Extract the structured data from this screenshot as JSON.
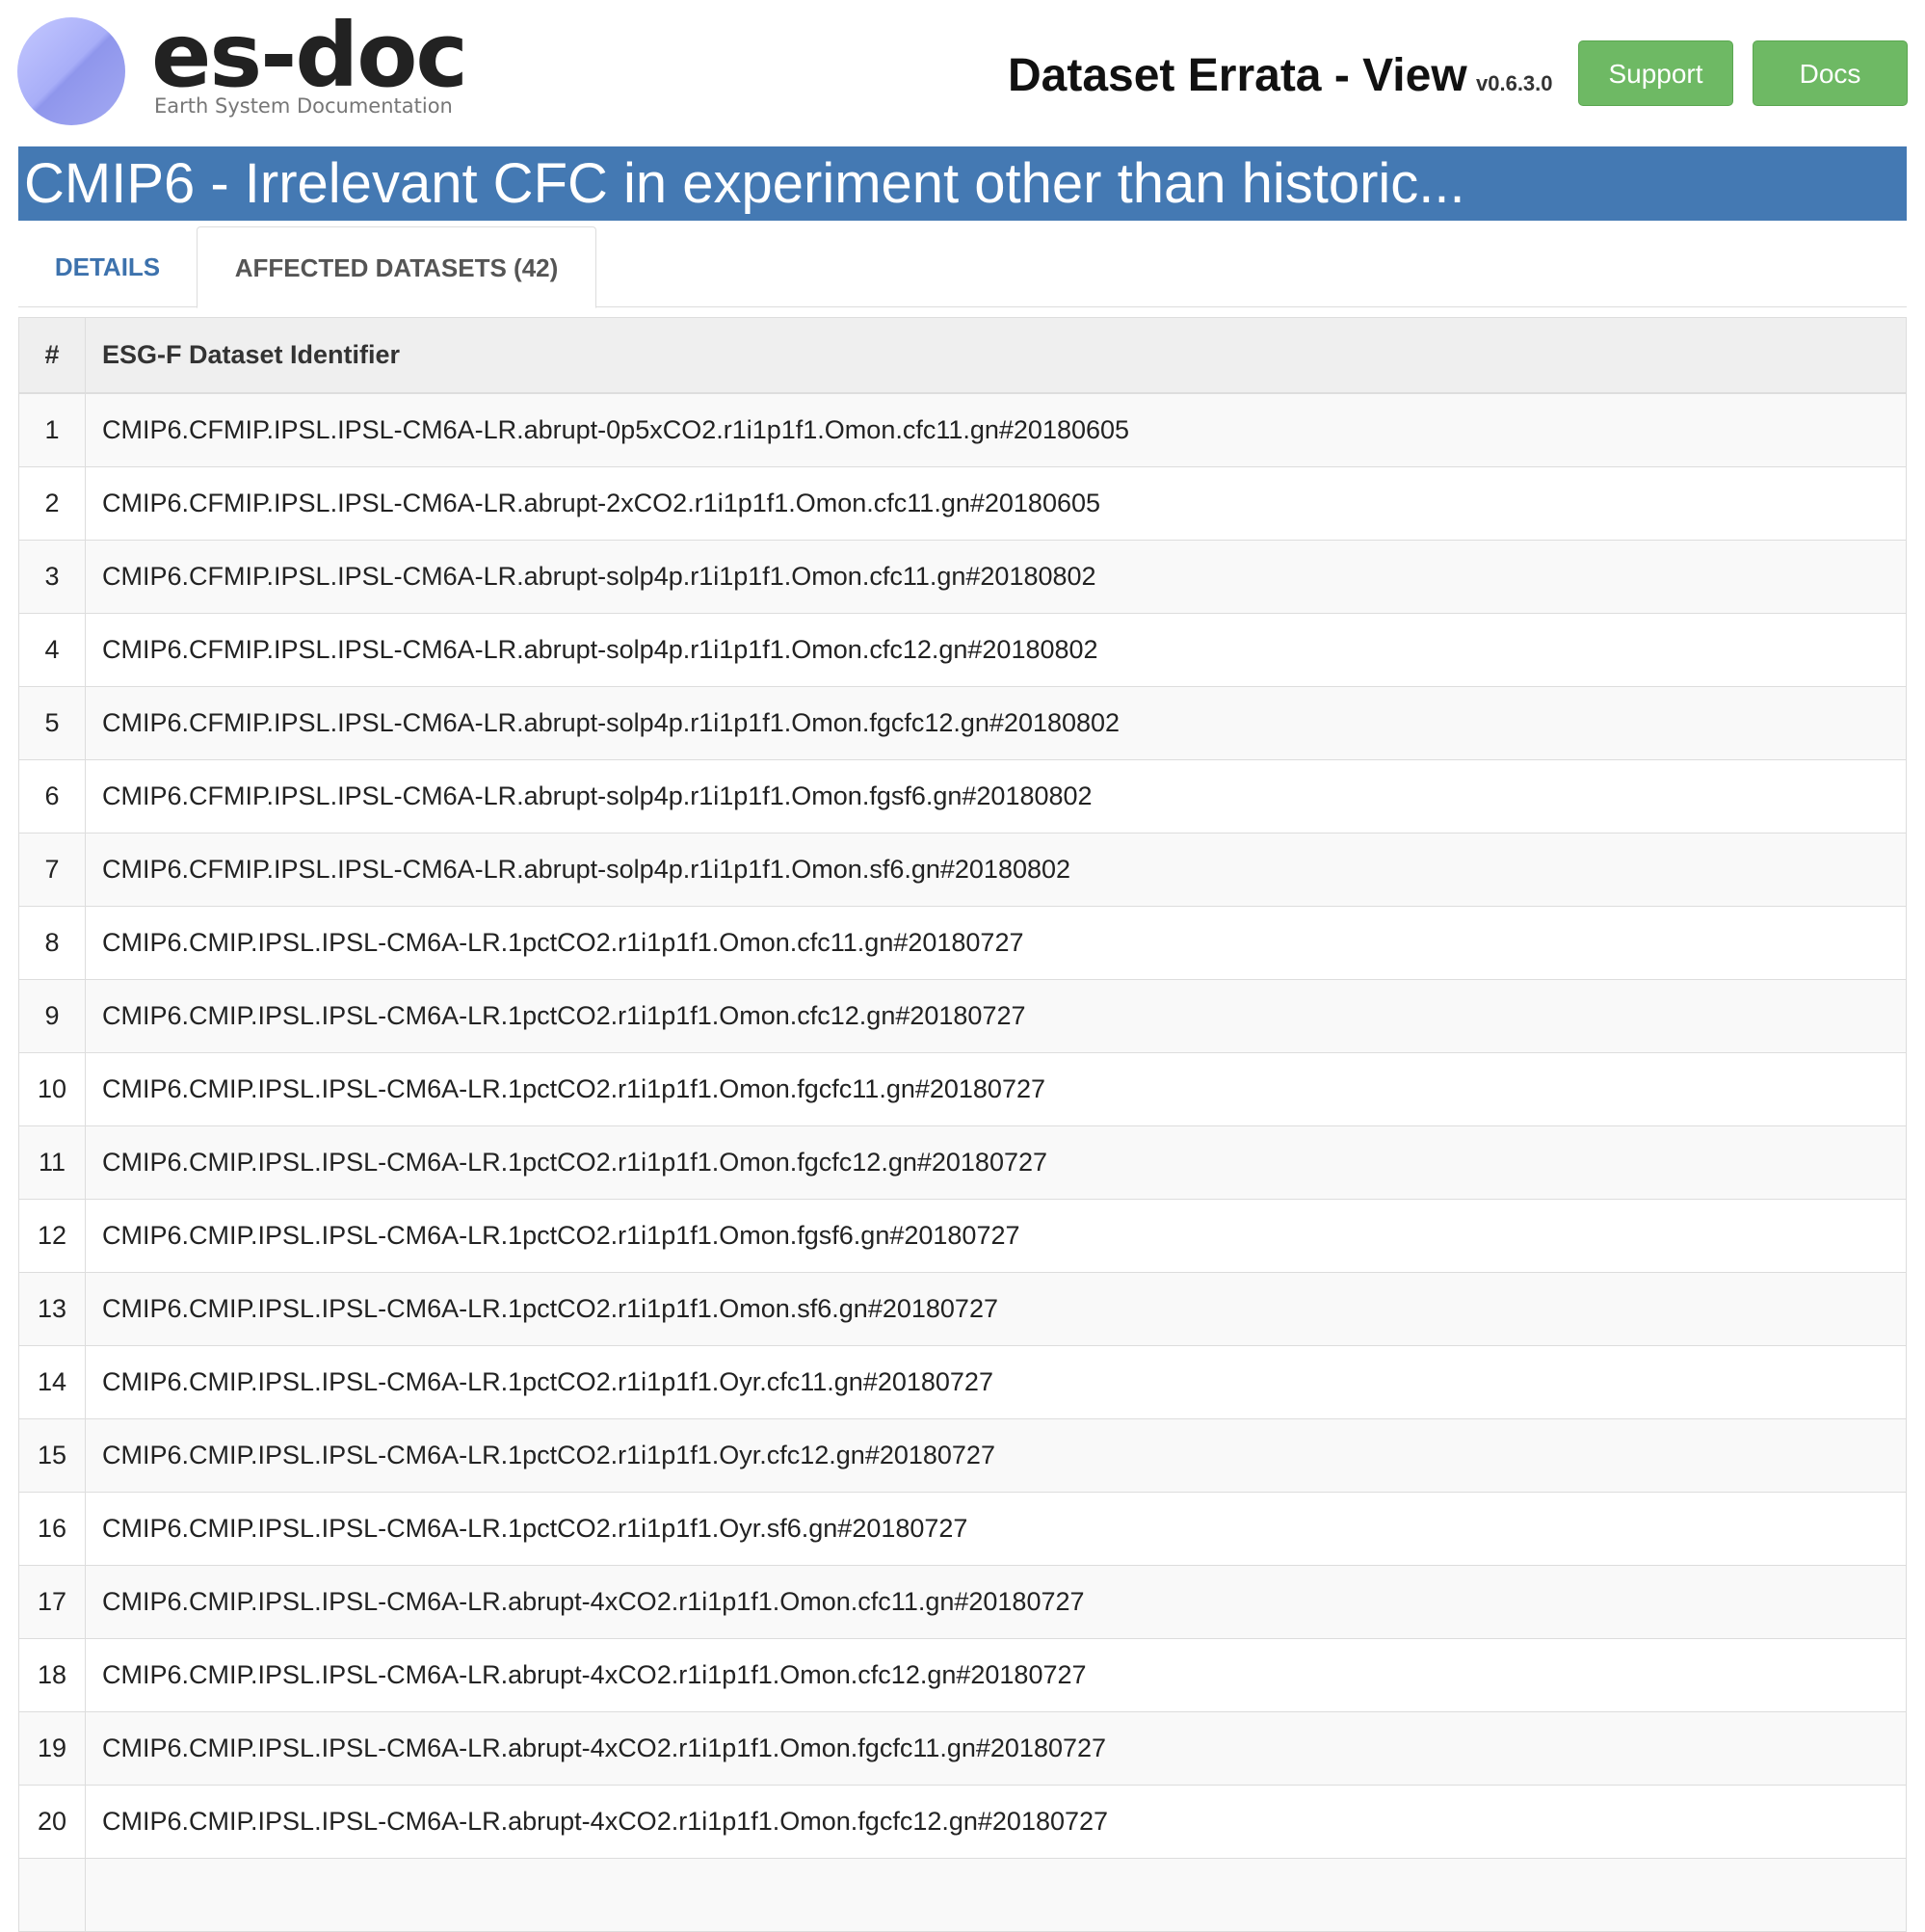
{
  "logo": {
    "wordmark": "es-doc",
    "tagline": "Earth System Documentation"
  },
  "header": {
    "title": "Dataset Errata - View",
    "version": "v0.6.3.0",
    "support_label": "Support",
    "docs_label": "Docs"
  },
  "colors": {
    "title_bar": "#4479b3",
    "button": "#6eb964",
    "active_link": "#3d72ad"
  },
  "issue": {
    "title": "CMIP6 - Irrelevant CFC in experiment other than historic..."
  },
  "tabs": [
    {
      "label": "DETAILS",
      "active": false
    },
    {
      "label": "AFFECTED DATASETS (42)",
      "active": true
    }
  ],
  "table": {
    "headers": [
      "#",
      "ESG-F Dataset Identifier"
    ],
    "rows": [
      [
        "1",
        "CMIP6.CFMIP.IPSL.IPSL-CM6A-LR.abrupt-0p5xCO2.r1i1p1f1.Omon.cfc11.gn#20180605"
      ],
      [
        "2",
        "CMIP6.CFMIP.IPSL.IPSL-CM6A-LR.abrupt-2xCO2.r1i1p1f1.Omon.cfc11.gn#20180605"
      ],
      [
        "3",
        "CMIP6.CFMIP.IPSL.IPSL-CM6A-LR.abrupt-solp4p.r1i1p1f1.Omon.cfc11.gn#20180802"
      ],
      [
        "4",
        "CMIP6.CFMIP.IPSL.IPSL-CM6A-LR.abrupt-solp4p.r1i1p1f1.Omon.cfc12.gn#20180802"
      ],
      [
        "5",
        "CMIP6.CFMIP.IPSL.IPSL-CM6A-LR.abrupt-solp4p.r1i1p1f1.Omon.fgcfc12.gn#20180802"
      ],
      [
        "6",
        "CMIP6.CFMIP.IPSL.IPSL-CM6A-LR.abrupt-solp4p.r1i1p1f1.Omon.fgsf6.gn#20180802"
      ],
      [
        "7",
        "CMIP6.CFMIP.IPSL.IPSL-CM6A-LR.abrupt-solp4p.r1i1p1f1.Omon.sf6.gn#20180802"
      ],
      [
        "8",
        "CMIP6.CMIP.IPSL.IPSL-CM6A-LR.1pctCO2.r1i1p1f1.Omon.cfc11.gn#20180727"
      ],
      [
        "9",
        "CMIP6.CMIP.IPSL.IPSL-CM6A-LR.1pctCO2.r1i1p1f1.Omon.cfc12.gn#20180727"
      ],
      [
        "10",
        "CMIP6.CMIP.IPSL.IPSL-CM6A-LR.1pctCO2.r1i1p1f1.Omon.fgcfc11.gn#20180727"
      ],
      [
        "11",
        "CMIP6.CMIP.IPSL.IPSL-CM6A-LR.1pctCO2.r1i1p1f1.Omon.fgcfc12.gn#20180727"
      ],
      [
        "12",
        "CMIP6.CMIP.IPSL.IPSL-CM6A-LR.1pctCO2.r1i1p1f1.Omon.fgsf6.gn#20180727"
      ],
      [
        "13",
        "CMIP6.CMIP.IPSL.IPSL-CM6A-LR.1pctCO2.r1i1p1f1.Omon.sf6.gn#20180727"
      ],
      [
        "14",
        "CMIP6.CMIP.IPSL.IPSL-CM6A-LR.1pctCO2.r1i1p1f1.Oyr.cfc11.gn#20180727"
      ],
      [
        "15",
        "CMIP6.CMIP.IPSL.IPSL-CM6A-LR.1pctCO2.r1i1p1f1.Oyr.cfc12.gn#20180727"
      ],
      [
        "16",
        "CMIP6.CMIP.IPSL.IPSL-CM6A-LR.1pctCO2.r1i1p1f1.Oyr.sf6.gn#20180727"
      ],
      [
        "17",
        "CMIP6.CMIP.IPSL.IPSL-CM6A-LR.abrupt-4xCO2.r1i1p1f1.Omon.cfc11.gn#20180727"
      ],
      [
        "18",
        "CMIP6.CMIP.IPSL.IPSL-CM6A-LR.abrupt-4xCO2.r1i1p1f1.Omon.cfc12.gn#20180727"
      ],
      [
        "19",
        "CMIP6.CMIP.IPSL.IPSL-CM6A-LR.abrupt-4xCO2.r1i1p1f1.Omon.fgcfc11.gn#20180727"
      ],
      [
        "20",
        "CMIP6.CMIP.IPSL.IPSL-CM6A-LR.abrupt-4xCO2.r1i1p1f1.Omon.fgcfc12.gn#20180727"
      ],
      [
        "",
        ""
      ]
    ]
  }
}
